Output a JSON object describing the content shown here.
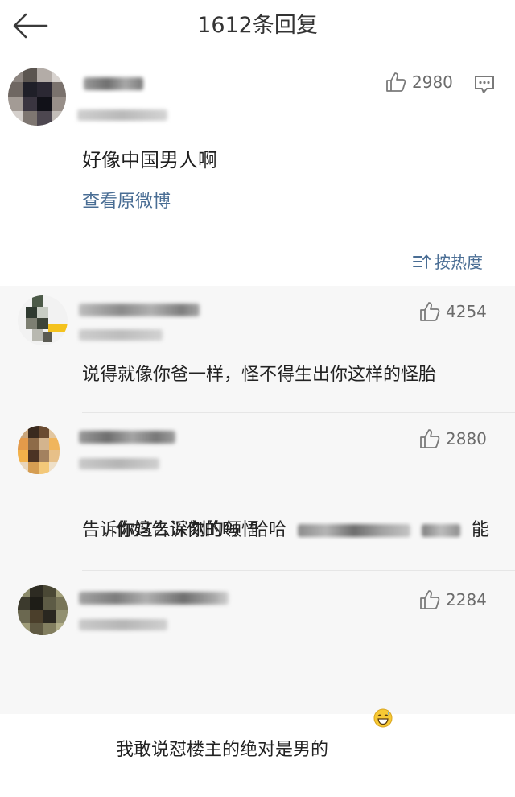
{
  "header": {
    "back_icon": "back-arrow-icon",
    "title": "1612条回复"
  },
  "main_post": {
    "avatar_icon": "user-avatar",
    "username": "",
    "like_icon": "thumbs-up-icon",
    "like_count": "2980",
    "comment_icon": "comment-bubble-icon",
    "content": "好像中国男人啊",
    "view_original": "查看原微博",
    "sort_icon": "sort-icon",
    "sort_label": "按热度"
  },
  "replies": [
    {
      "avatar_icon": "user-avatar",
      "like_icon": "thumbs-up-icon",
      "like_count": "4254",
      "content": "说得就像你爸一样，怪不得生出你这样的怪胎"
    },
    {
      "avatar_icon": "user-avatar",
      "like_icon": "thumbs-up-icon",
      "like_count": "2880",
      "content_before": "你妈告诉你的吗  哈哈  ",
      "content_after": "  能",
      "content_line2": "告诉你这么深刻的领悟"
    },
    {
      "avatar_icon": "user-avatar",
      "like_icon": "thumbs-up-icon",
      "like_count": "2284",
      "content": "我敢说怼楼主的绝对是男的",
      "emoji_icon": "grinning-sweat-emoji-icon"
    }
  ],
  "colors": {
    "link": "#496d94",
    "reply_bg": "#f7f7f7",
    "count_text": "#6b6b6b"
  }
}
